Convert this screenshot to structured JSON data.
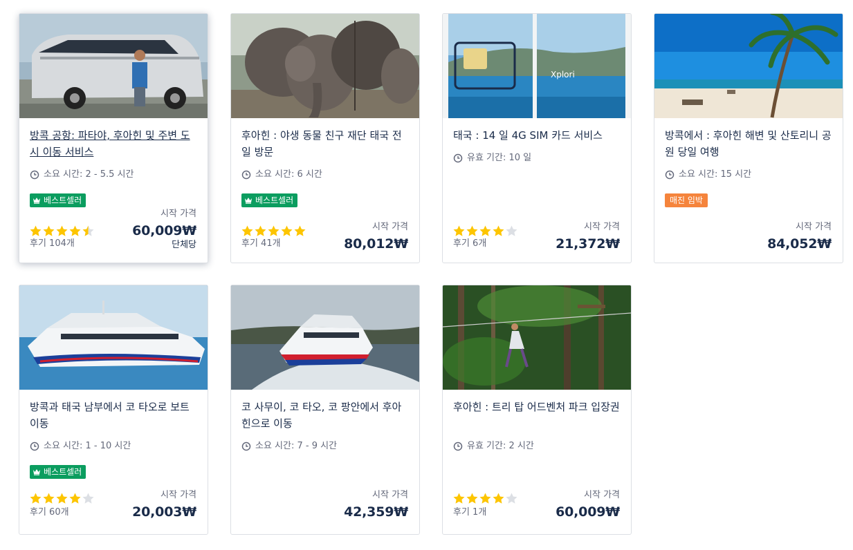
{
  "colors": {
    "bestseller": "#0b9d5f",
    "urgent": "#f5843c",
    "star": "#fdc500",
    "star_empty": "#dcdfe4",
    "text": "#1a2b49",
    "muted": "#63687a"
  },
  "cards": [
    {
      "title": "방콕 공항: 파타야, 후아힌 및 주변 도시 이동 서비스",
      "duration": "소요 시간: 2 - 5.5 시간",
      "badge": "베스트셀러",
      "rating": 4.5,
      "reviews": "후기 104개",
      "price_label": "시작 가격",
      "price": "60,009₩",
      "per": "단체당",
      "image": "van"
    },
    {
      "title": "후아힌 : 야생 동물 친구 재단 태국 전일 방문",
      "duration": "소요 시간: 6 시간",
      "badge": "베스트셀러",
      "rating": 5,
      "reviews": "후기 41개",
      "price_label": "시작 가격",
      "price": "80,012₩",
      "image": "elephants"
    },
    {
      "title": "태국 : 14 일 4G SIM 카드 서비스",
      "duration": "유효 기간: 10 일",
      "rating": 4,
      "reviews": "후기 6개",
      "price_label": "시작 가격",
      "price": "21,372₩",
      "image": "sim"
    },
    {
      "title": "방콕에서 : 후아힌 해변 및 산토리니 공원 당일 여행",
      "duration": "소요 시간: 15 시간",
      "badge": "매진 임박",
      "price_label": "시작 가격",
      "price": "84,052₩",
      "image": "beach"
    },
    {
      "title": "방콕과 태국 남부에서 코 타오로 보트 이동",
      "duration": "소요 시간: 1 - 10 시간",
      "badge": "베스트셀러",
      "rating": 4,
      "reviews": "후기 60개",
      "price_label": "시작 가격",
      "price": "20,003₩",
      "image": "ferry"
    },
    {
      "title": "코 사무이, 코 타오, 코 팡안에서 후아힌으로 이동",
      "duration": "소요 시간: 7 - 9 시간",
      "price_label": "시작 가격",
      "price": "42,359₩",
      "image": "catamaran"
    },
    {
      "title": "후아힌 : 트리 탑 어드벤처 파크 입장권",
      "duration": "유효 기간: 2 시간",
      "rating": 4,
      "reviews": "후기 1개",
      "price_label": "시작 가격",
      "price": "60,009₩",
      "image": "jungle"
    }
  ]
}
